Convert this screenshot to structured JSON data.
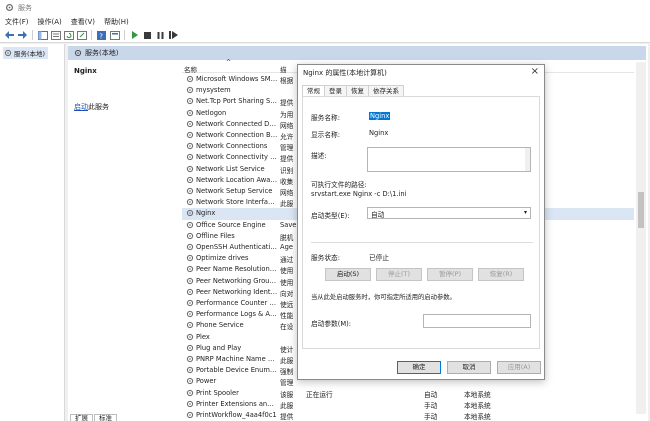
{
  "window": {
    "title": "服务"
  },
  "menu": [
    "文件(F)",
    "操作(A)",
    "查看(V)",
    "帮助(H)"
  ],
  "colors": {
    "accent": "#0078d7",
    "selection": "#dbe6f4",
    "header": "#c9d7ea",
    "link": "#1a4fc0"
  },
  "tree": {
    "item": "服务(本地)"
  },
  "content": {
    "header": "服务(本地)",
    "detail_title": "Nginx",
    "detail_link": "启动",
    "detail_link_suffix": "此服务",
    "columns": {
      "name": "名称",
      "description": "描"
    }
  },
  "services": [
    {
      "name": "Microsoft Windows SMS ...",
      "desc": "根据",
      "status": "",
      "startup": "",
      "logon": ""
    },
    {
      "name": "mysystem",
      "desc": "",
      "status": "",
      "startup": "",
      "logon": ""
    },
    {
      "name": "Net.Tcp Port Sharing Ser...",
      "desc": "提供",
      "status": "",
      "startup": "",
      "logon": ""
    },
    {
      "name": "Netlogon",
      "desc": "为用",
      "status": "",
      "startup": "",
      "logon": ""
    },
    {
      "name": "Network Connected Devi...",
      "desc": "网络",
      "status": "",
      "startup": "",
      "logon": ""
    },
    {
      "name": "Network Connection Bro...",
      "desc": "允许",
      "status": "",
      "startup": "",
      "logon": ""
    },
    {
      "name": "Network Connections",
      "desc": "管理",
      "status": "",
      "startup": "",
      "logon": ""
    },
    {
      "name": "Network Connectivity Ass...",
      "desc": "提供",
      "status": "",
      "startup": "",
      "logon": ""
    },
    {
      "name": "Network List Service",
      "desc": "识别",
      "status": "",
      "startup": "",
      "logon": ""
    },
    {
      "name": "Network Location Aware...",
      "desc": "收集",
      "status": "",
      "startup": "",
      "logon": ""
    },
    {
      "name": "Network Setup Service",
      "desc": "网络",
      "status": "",
      "startup": "",
      "logon": ""
    },
    {
      "name": "Network Store Interface ...",
      "desc": "此服",
      "status": "",
      "startup": "",
      "logon": ""
    },
    {
      "name": "Nginx",
      "desc": "",
      "status": "",
      "startup": "",
      "logon": ""
    },
    {
      "name": "Office Source Engine",
      "desc": "Save",
      "status": "",
      "startup": "",
      "logon": ""
    },
    {
      "name": "Offline Files",
      "desc": "脱机",
      "status": "",
      "startup": "",
      "logon": ""
    },
    {
      "name": "OpenSSH Authentication ...",
      "desc": "Age",
      "status": "",
      "startup": "",
      "logon": ""
    },
    {
      "name": "Optimize drives",
      "desc": "通过",
      "status": "",
      "startup": "",
      "logon": ""
    },
    {
      "name": "Peer Name Resolution Pr...",
      "desc": "使用",
      "status": "",
      "startup": "",
      "logon": ""
    },
    {
      "name": "Peer Networking Groupi...",
      "desc": "使用",
      "status": "",
      "startup": "",
      "logon": ""
    },
    {
      "name": "Peer Networking Identity...",
      "desc": "向对",
      "status": "",
      "startup": "",
      "logon": ""
    },
    {
      "name": "Performance Counter DL...",
      "desc": "使远",
      "status": "",
      "startup": "",
      "logon": ""
    },
    {
      "name": "Performance Logs & Aler...",
      "desc": "性能",
      "status": "",
      "startup": "",
      "logon": ""
    },
    {
      "name": "Phone Service",
      "desc": "在设",
      "status": "",
      "startup": "",
      "logon": ""
    },
    {
      "name": "Plex",
      "desc": "",
      "status": "",
      "startup": "",
      "logon": ""
    },
    {
      "name": "Plug and Play",
      "desc": "使计",
      "status": "",
      "startup": "",
      "logon": ""
    },
    {
      "name": "PNRP Machine Name Pu...",
      "desc": "此服",
      "status": "",
      "startup": "",
      "logon": ""
    },
    {
      "name": "Portable Device Enumera...",
      "desc": "强制",
      "status": "",
      "startup": "",
      "logon": ""
    },
    {
      "name": "Power",
      "desc": "管理",
      "status": "",
      "startup": "",
      "logon": ""
    },
    {
      "name": "Print Spooler",
      "desc": "该服",
      "status": "正在运行",
      "startup": "自动",
      "logon": "本地系统"
    },
    {
      "name": "Printer Extensions and N...",
      "desc": "此服",
      "status": "",
      "startup": "手动",
      "logon": "本地系统"
    },
    {
      "name": "PrintWorkflow_4aa4f0c1",
      "desc": "提供",
      "status": "",
      "startup": "手动",
      "logon": "本地系统"
    }
  ],
  "bottom_tabs": [
    "扩展",
    "标准"
  ],
  "dialog": {
    "title": "Nginx 的属性(本地计算机)",
    "close": "×",
    "tabs": [
      "常规",
      "登录",
      "恢复",
      "依存关系"
    ],
    "service_name_label": "服务名称:",
    "service_name": "Nginx",
    "display_name_label": "显示名称:",
    "display_name": "Nginx",
    "description_label": "描述:",
    "exe_path_label": "可执行文件的路径:",
    "exe_path": "srvstart.exe Nginx -c D:\\1.ini",
    "startup_type_label": "启动类型(E):",
    "startup_type": "自动",
    "service_status_label": "服务状态:",
    "service_status": "已停止",
    "buttons": {
      "start": "启动(S)",
      "stop": "停止(T)",
      "pause": "暂停(P)",
      "resume": "恢复(R)"
    },
    "hint": "当从此处启动服务时，你可指定所适用的启动参数。",
    "start_params_label": "启动参数(M):",
    "ok": "确定",
    "cancel": "取消",
    "apply": "应用(A)"
  }
}
